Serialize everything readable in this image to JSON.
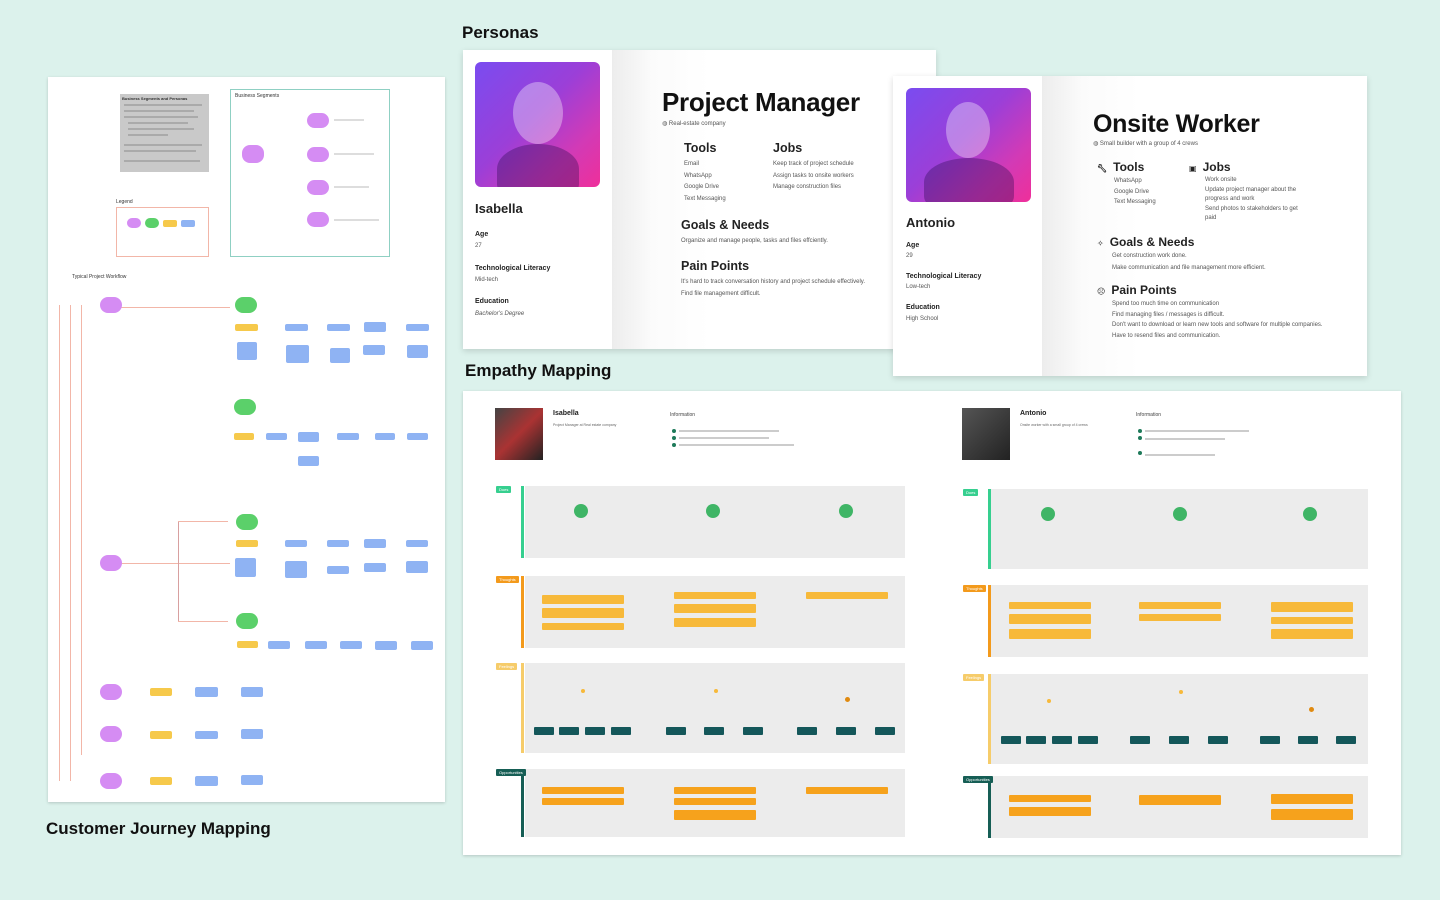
{
  "sections": {
    "personas": "Personas",
    "empathy": "Empathy Mapping",
    "journey": "Customer Journey Mapping"
  },
  "journey_board": {
    "segments_title": "Business Segments and Personas",
    "business_segments": "Business Segments",
    "legend": "Legend",
    "workflow": "Typical Project Workflow"
  },
  "persona1": {
    "name": "Isabella",
    "title": "Project Manager",
    "company": "Real-estate company",
    "age_label": "Age",
    "age": "27",
    "lit_label": "Technological Literacy",
    "lit": "Mid-tech",
    "edu_label": "Education",
    "edu": "Bachelor's Degree",
    "tools_label": "Tools",
    "tools": [
      "Email",
      "WhatsApp",
      "Google Drive",
      "Text Messaging"
    ],
    "jobs_label": "Jobs",
    "jobs": [
      "Keep track of project schedule",
      "Assign tasks to onsite workers",
      "Manage construction files"
    ],
    "goals_label": "Goals & Needs",
    "goals": [
      "Organize and manage people, tasks and files effciently."
    ],
    "pain_label": "Pain Points",
    "pain": [
      "It's hard to track conversation history and project schedule effectively.",
      "Find file management difficult."
    ]
  },
  "persona2": {
    "name": "Antonio",
    "title": "Onsite Worker",
    "company": "Small builder with a group of 4 crews",
    "age_label": "Age",
    "age": "29",
    "lit_label": "Technological Literacy",
    "lit": "Low-tech",
    "edu_label": "Education",
    "edu": "High School",
    "tools_label": "Tools",
    "tools": [
      "WhatsApp",
      "Google Drive",
      "Text Messaging"
    ],
    "jobs_label": "Jobs",
    "jobs": [
      "Work onsite",
      "Update project manager about the",
      "progress and work",
      "Send photos to stakeholders to get",
      "paid"
    ],
    "goals_label": "Goals & Needs",
    "goals": [
      "Get construction work done.",
      "Make communication and file management more efficient."
    ],
    "pain_label": "Pain Points",
    "pain": [
      "Spend too much time on communication",
      "Find managing files / messages is difficult.",
      "Don't want to download or learn new tools and software for multiple companies.",
      "Have to resend files and communication."
    ]
  },
  "empathy_board": {
    "p1_name": "Isabella",
    "p1_role": "Project Manager at Real estate company",
    "p2_name": "Antonio",
    "p2_role": "Onsite worker with a small group of 4 crews",
    "info": "Information",
    "lanes": [
      "Does",
      "Thoughts",
      "Feelings",
      "Opportunities"
    ]
  },
  "colors": {
    "background": "#dcf2ec",
    "purple_node": "#d58cf3",
    "green_node": "#5bd06a",
    "yellow_node": "#f6c94b",
    "blue_node": "#8fb3f3",
    "teal_chip": "#14575a",
    "orange_note": "#f7b93a"
  }
}
